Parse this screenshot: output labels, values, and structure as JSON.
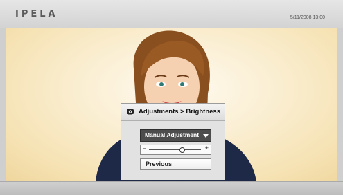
{
  "header": {
    "brand": "IPELA",
    "datetime": "5/11/2008 13:00"
  },
  "menu": {
    "icon": "camera-icon",
    "title": "Adjustments > Brightness",
    "mode_select": {
      "selected": "Manual Adjustment",
      "icon": "chevron-down-icon"
    },
    "brightness_slider": {
      "minus_label": "–",
      "plus_label": "+",
      "value_fraction": 0.62
    },
    "previous_label": "Previous"
  },
  "colors": {
    "background": "#fbf0d6",
    "dropdown": "#4d4d4d",
    "panel": "#e2e2e2"
  }
}
